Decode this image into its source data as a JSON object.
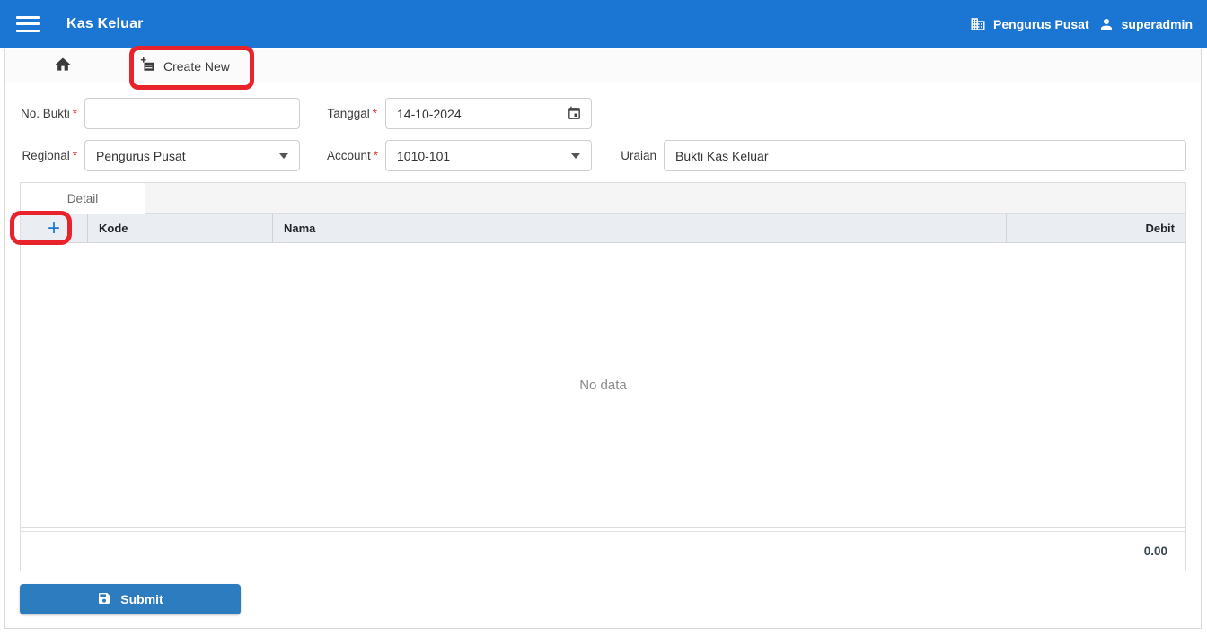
{
  "appbar": {
    "title": "Kas Keluar",
    "organization": "Pengurus Pusat",
    "username": "superadmin"
  },
  "toolbar": {
    "create_new_label": "Create New"
  },
  "form": {
    "no_bukti": {
      "label": "No. Bukti",
      "required_mark": "*",
      "value": ""
    },
    "tanggal": {
      "label": "Tanggal",
      "required_mark": "*",
      "value": "14-10-2024"
    },
    "regional": {
      "label": "Regional",
      "required_mark": "*",
      "value": "Pengurus Pusat"
    },
    "account": {
      "label": "Account",
      "required_mark": "*",
      "value": "1010-101"
    },
    "uraian": {
      "label": "Uraian",
      "value": "Bukti Kas Keluar"
    }
  },
  "detail": {
    "tab_label": "Detail",
    "columns": [
      "Kode",
      "Nama",
      "Debit"
    ],
    "empty_text": "No data",
    "total": "0.00"
  },
  "submit": {
    "label": "Submit"
  },
  "icons": {
    "plus": "+"
  },
  "colors": {
    "appbar_blue": "#1b76d3",
    "submit_blue": "#2e7cc0",
    "annotation_red": "#e8232b",
    "required_red": "#e53935",
    "grid_header_bg": "#eaedf1"
  }
}
